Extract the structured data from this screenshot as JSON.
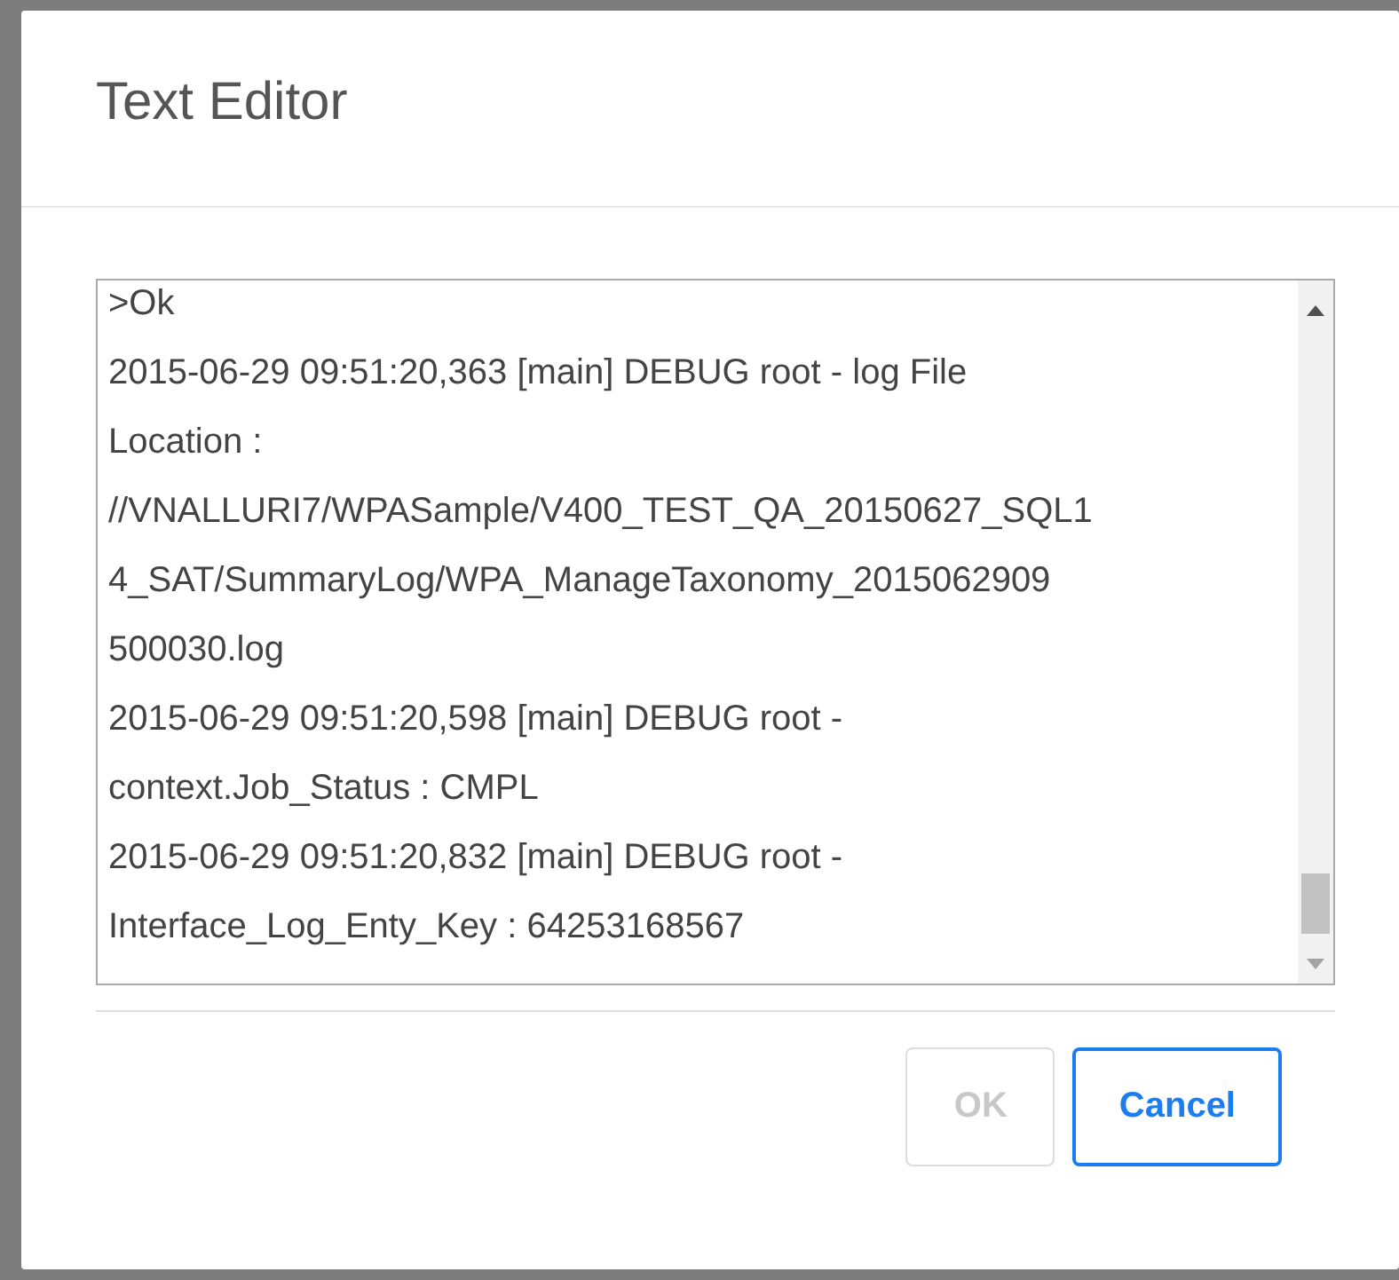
{
  "dialog": {
    "title": "Text Editor"
  },
  "editor": {
    "lines": [
      ">Ok",
      "2015-06-29 09:51:20,363 [main] DEBUG root  - log File",
      "Location :",
      "//VNALLURI7/WPASample/V400_TEST_QA_20150627_SQL1",
      "4_SAT/SummaryLog/WPA_ManageTaxonomy_2015062909",
      "500030.log",
      "2015-06-29 09:51:20,598 [main] DEBUG root  -",
      "context.Job_Status : CMPL",
      "2015-06-29 09:51:20,832 [main] DEBUG root  -",
      "Interface_Log_Enty_Key : 64253168567"
    ]
  },
  "buttons": [
    {
      "label": "OK",
      "disabled": true
    },
    {
      "label": "Cancel",
      "disabled": false
    }
  ]
}
